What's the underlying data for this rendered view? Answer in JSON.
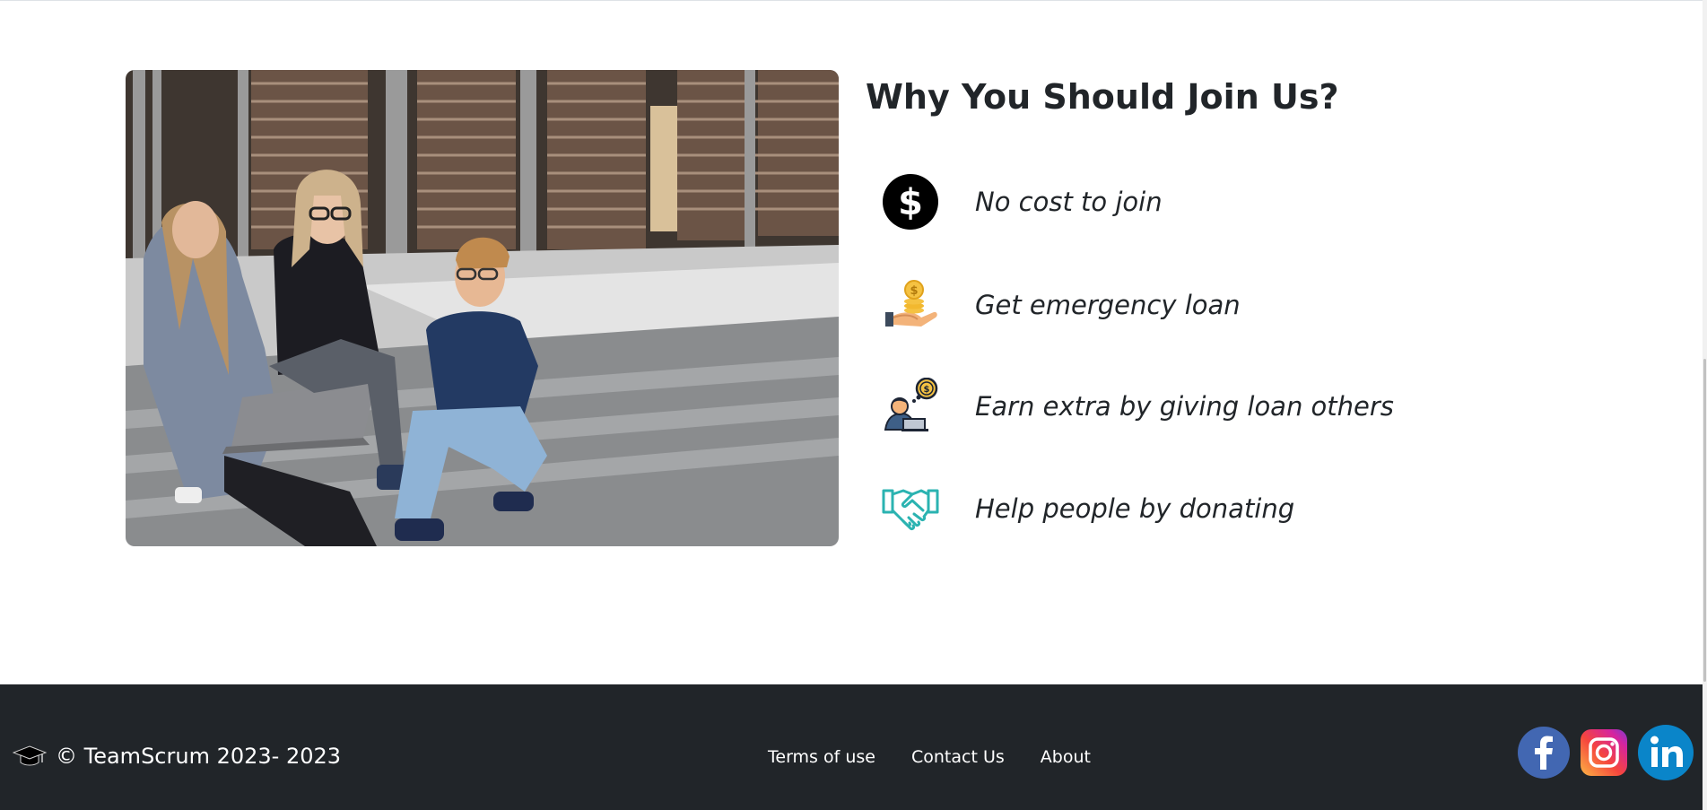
{
  "hero": {
    "image_alt": "Three young people sitting on outdoor steps with a laptop and phone"
  },
  "join": {
    "title": "Why You Should Join Us?",
    "benefits": [
      {
        "icon": "dollar-coin-icon",
        "text": "No cost to join"
      },
      {
        "icon": "hand-holding-coins-icon",
        "text": "Get emergency loan"
      },
      {
        "icon": "person-laptop-thinking-money-icon",
        "text": "Earn extra by giving loan others"
      },
      {
        "icon": "handshake-icon",
        "text": "Help people by donating"
      }
    ]
  },
  "footer": {
    "brand": "© TeamScrum 2023- 2023",
    "brand_icon": "graduation-cap-icon",
    "links": [
      {
        "label": "Terms of use"
      },
      {
        "label": "Contact Us"
      },
      {
        "label": "About"
      }
    ],
    "socials": [
      {
        "name": "facebook-icon",
        "color": "#4267b2"
      },
      {
        "name": "instagram-icon",
        "color": "#d6249f"
      },
      {
        "name": "linkedin-icon",
        "color": "#0a85c9"
      }
    ]
  },
  "colors": {
    "footer_bg": "#212529",
    "text": "#212529",
    "handshake": "#2bb3b1"
  }
}
